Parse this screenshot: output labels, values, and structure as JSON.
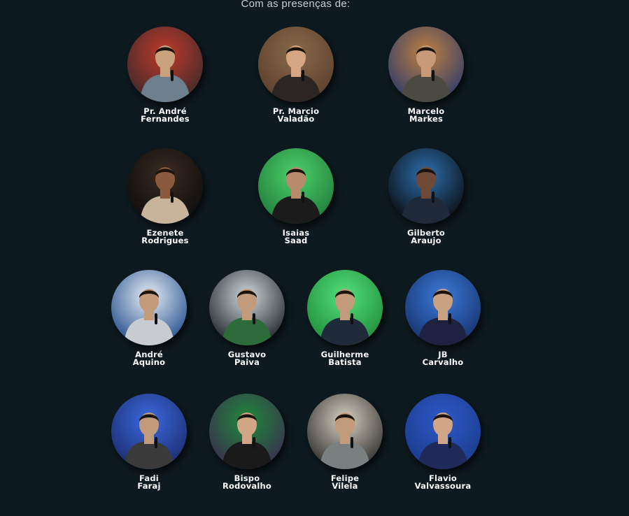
{
  "intro_text": "Com as presenças de:",
  "speakers": [
    {
      "line1": "Pr. André",
      "line2": "Fernandes",
      "bg": "#3a2a2a",
      "accent": "#c0392b",
      "skin": "#c9a27e",
      "shirt": "#6d7f8c"
    },
    {
      "line1": "Pr. Marcio",
      "line2": "Valadão",
      "bg": "#5a3e2c",
      "accent": "#8a6a4a",
      "skin": "#d6a582",
      "shirt": "#2b2523"
    },
    {
      "line1": "Marcelo",
      "line2": "Markes",
      "bg": "#2a3a6a",
      "accent": "#c08040",
      "skin": "#c79a7a",
      "shirt": "#4a4a40"
    },
    {
      "line1": "Ezenete",
      "line2": "Rodrigues",
      "bg": "#0c0c0c",
      "accent": "#3a2a20",
      "skin": "#8a5a3e",
      "shirt": "#c8b49a"
    },
    {
      "line1": "Isaias",
      "line2": "Saad",
      "bg": "#1f7a3a",
      "accent": "#4cd06a",
      "skin": "#b88a6e",
      "shirt": "#1b1b1b"
    },
    {
      "line1": "Gilberto",
      "line2": "Araujo",
      "bg": "#0a0a0a",
      "accent": "#2d6fb0",
      "skin": "#6e4a36",
      "shirt": "#1e2a3a"
    },
    {
      "line1": "André",
      "line2": "Aquino",
      "bg": "#1e4a8a",
      "accent": "#e8eef5",
      "skin": "#c29a7c",
      "shirt": "#c8cbd0"
    },
    {
      "line1": "Gustavo",
      "line2": "Paiva",
      "bg": "#1a1f24",
      "accent": "#cfd8dc",
      "skin": "#c29a7c",
      "shirt": "#2e6b3a"
    },
    {
      "line1": "Guilherme",
      "line2": "Batista",
      "bg": "#1f8a3a",
      "accent": "#53e07a",
      "skin": "#c29a7c",
      "shirt": "#1f2a3a"
    },
    {
      "line1": "JB",
      "line2": "Carvalho",
      "bg": "#15306a",
      "accent": "#3b7ad8",
      "skin": "#c9a282",
      "shirt": "#1c2240"
    },
    {
      "line1": "Fadi",
      "line2": "Faraj",
      "bg": "#1a2a6a",
      "accent": "#3b6ae0",
      "skin": "#c29a7c",
      "shirt": "#3a3a3a"
    },
    {
      "line1": "Bispo",
      "line2": "Rodovalho",
      "bg": "#3a2a50",
      "accent": "#1f8a3a",
      "skin": "#d0a686",
      "shirt": "#1a1a1a"
    },
    {
      "line1": "Felipe",
      "line2": "Vilela",
      "bg": "#2a2a2a",
      "accent": "#d8d0c0",
      "skin": "#c29a7c",
      "shirt": "#7a8080"
    },
    {
      "line1": "Flavio",
      "line2": "Valvassoura",
      "bg": "#1a3a8a",
      "accent": "#2d5ac8",
      "skin": "#d0a686",
      "shirt": "#1f2a5a"
    }
  ]
}
